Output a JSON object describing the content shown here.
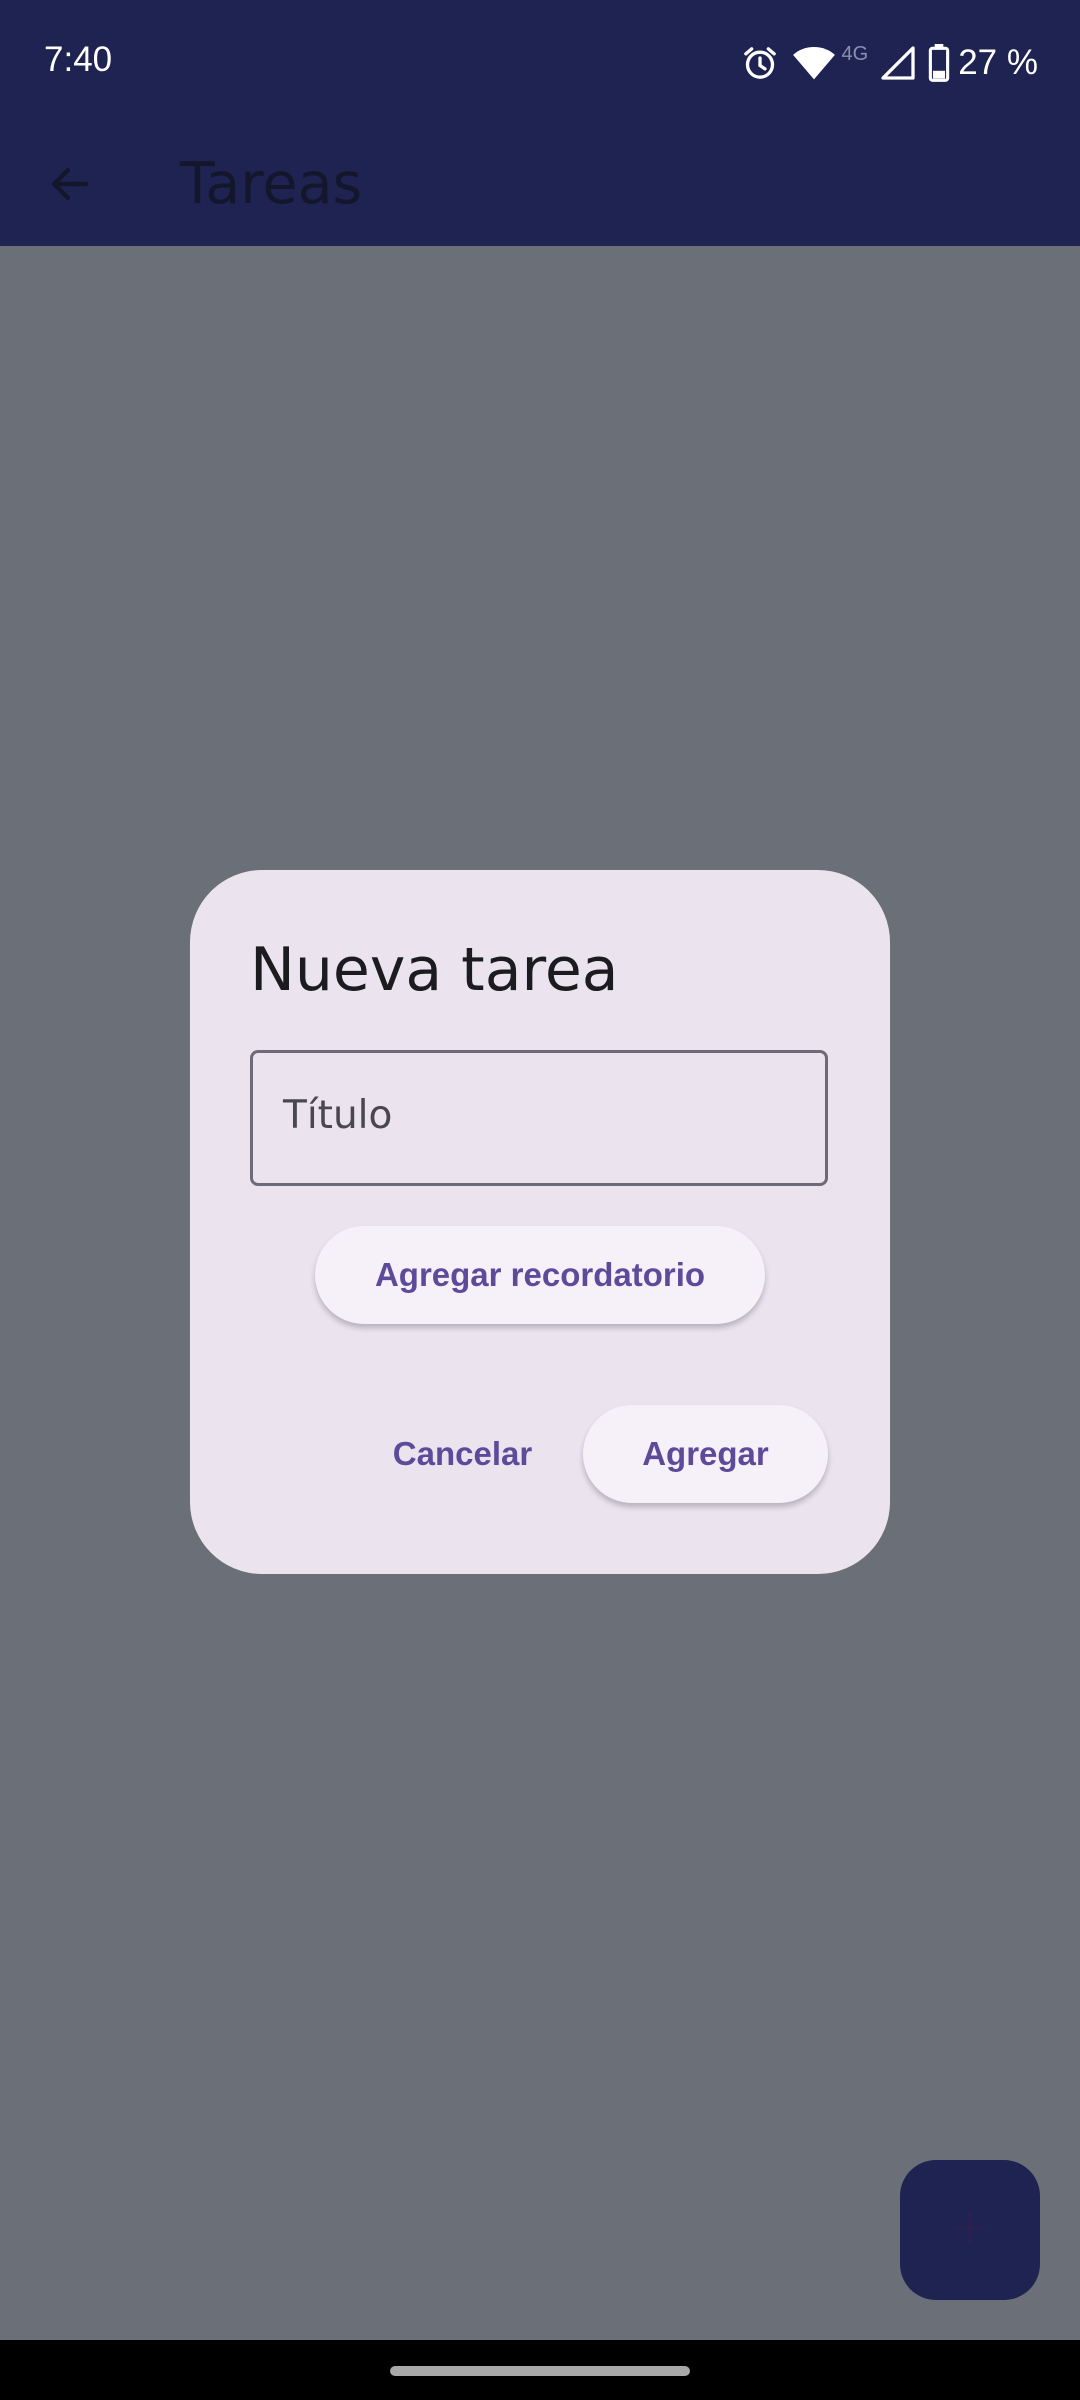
{
  "status_bar": {
    "time": "7:40",
    "network_type": "4G",
    "battery_percent": "27 %",
    "icons": [
      "alarm-icon",
      "wifi-icon",
      "cell-signal-icon",
      "battery-icon"
    ]
  },
  "app_bar": {
    "title": "Tareas",
    "back_icon": "arrow-back-icon"
  },
  "dialog": {
    "title": "Nueva tarea",
    "title_field": {
      "label": "Título",
      "value": ""
    },
    "reminder_button_label": "Agregar recordatorio",
    "cancel_label": "Cancelar",
    "add_label": "Agregar"
  },
  "fab": {
    "icon": "plus-icon"
  },
  "colors": {
    "app_bar": "#1e2352",
    "scrim_background": "#6a6f78",
    "dialog_surface": "#ebe4ef",
    "accent": "#5d4b9a"
  }
}
